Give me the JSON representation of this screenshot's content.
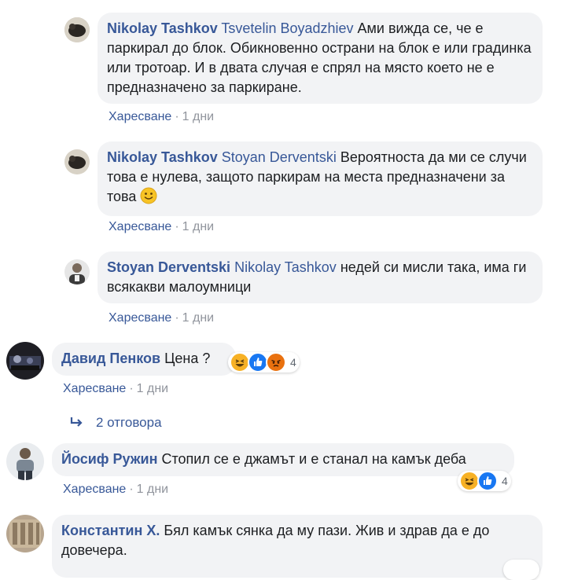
{
  "comments": [
    {
      "author": "Nikolay Tashkov",
      "tagged": "Tsvetelin Boyadzhiev",
      "text": "Ами вижда се, че е паркирал до блок. Обикновенно острани на блок е или градинка или тротоар. И в двата случая е спрял на място което не е предназначено за паркиране.",
      "like_label": "Харесване",
      "time": "1 дни"
    },
    {
      "author": "Nikolay Tashkov",
      "tagged": "Stoyan Derventski",
      "text": "Вероятноста да ми се случи това е нулева, защото паркирам на места предназначени за това",
      "emoji": "slightly-smiling-face",
      "like_label": "Харесване",
      "time": "1 дни"
    },
    {
      "author": "Stoyan Derventski",
      "tagged": "Nikolay Tashkov",
      "text": "недей си мисли така, има ги всякакви малоумници",
      "like_label": "Харесване",
      "time": "1 дни"
    },
    {
      "author": "Давид Пенков",
      "text": "Цена ?",
      "like_label": "Харесване",
      "time": "1 дни",
      "reactions": [
        "haha",
        "like",
        "angry"
      ],
      "reaction_count": "4",
      "replies_label": "2 отговора"
    },
    {
      "author": "Йосиф Ружин",
      "text": "Стопил се е джамът и е станал на камък деба",
      "like_label": "Харесване",
      "time": "1 дни",
      "reactions": [
        "haha",
        "like"
      ],
      "reaction_count": "4"
    },
    {
      "author": "Константин Х.",
      "text": "Бял камък сянка да му пази. Жив и здрав да е до довечера."
    }
  ],
  "colors": {
    "link": "#385898",
    "bubble": "#f2f3f5",
    "muted": "#90949c"
  }
}
